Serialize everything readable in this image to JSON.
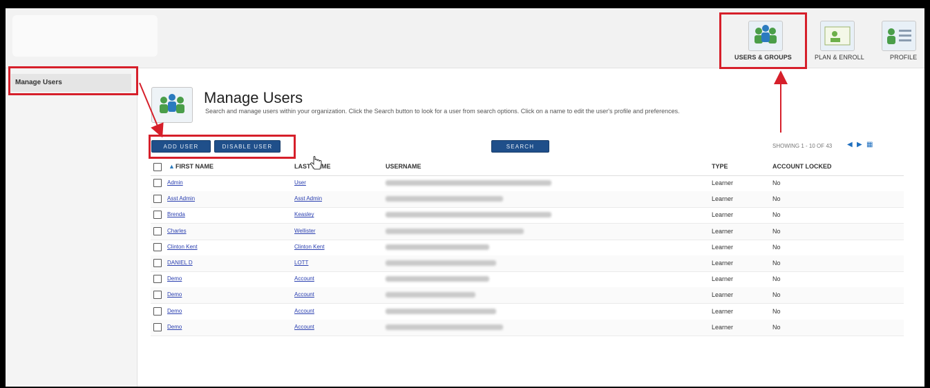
{
  "header": {
    "nav": [
      {
        "label": "USERS & GROUPS",
        "icon": "users-groups-icon"
      },
      {
        "label": "PLAN & ENROLL",
        "icon": "plan-enroll-icon"
      },
      {
        "label": "PROFILE",
        "icon": "profile-icon"
      }
    ]
  },
  "sidebar": {
    "items": [
      {
        "label": "Manage Users"
      }
    ]
  },
  "main": {
    "title": "Manage Users",
    "description": "Search and manage users within your organization. Click the Search button to look for a user from search options. Click on a name to edit the user's profile and preferences.",
    "buttons": {
      "add_user": "ADD USER",
      "disable_user": "DISABLE USER",
      "search": "SEARCH"
    },
    "pagination": {
      "showing": "SHOWING 1 - 10 OF 43"
    },
    "table": {
      "columns": [
        "FIRST NAME",
        "LAST NAME",
        "USERNAME",
        "TYPE",
        "ACCOUNT LOCKED"
      ],
      "rows": [
        {
          "first": "Admin",
          "last": "User",
          "type": "Learner",
          "locked": "No"
        },
        {
          "first": "Asst Admin",
          "last": "Asst Admin",
          "type": "Learner",
          "locked": "No"
        },
        {
          "first": "Brenda",
          "last": "Keasley",
          "type": "Learner",
          "locked": "No"
        },
        {
          "first": "Charles",
          "last": "Wellister",
          "type": "Learner",
          "locked": "No"
        },
        {
          "first": "Clinton Kent",
          "last": "Clinton Kent",
          "type": "Learner",
          "locked": "No"
        },
        {
          "first": "DANIEL D",
          "last": "LOTT",
          "type": "Learner",
          "locked": "No"
        },
        {
          "first": "Demo",
          "last": "Account",
          "type": "Learner",
          "locked": "No"
        },
        {
          "first": "Demo",
          "last": "Account",
          "type": "Learner",
          "locked": "No"
        },
        {
          "first": "Demo",
          "last": "Account",
          "type": "Learner",
          "locked": "No"
        },
        {
          "first": "Demo",
          "last": "Account",
          "type": "Learner",
          "locked": "No"
        }
      ]
    }
  },
  "colors": {
    "accent": "#1f4f8a",
    "highlight": "#d61f2a",
    "link": "#2a3fb0"
  }
}
